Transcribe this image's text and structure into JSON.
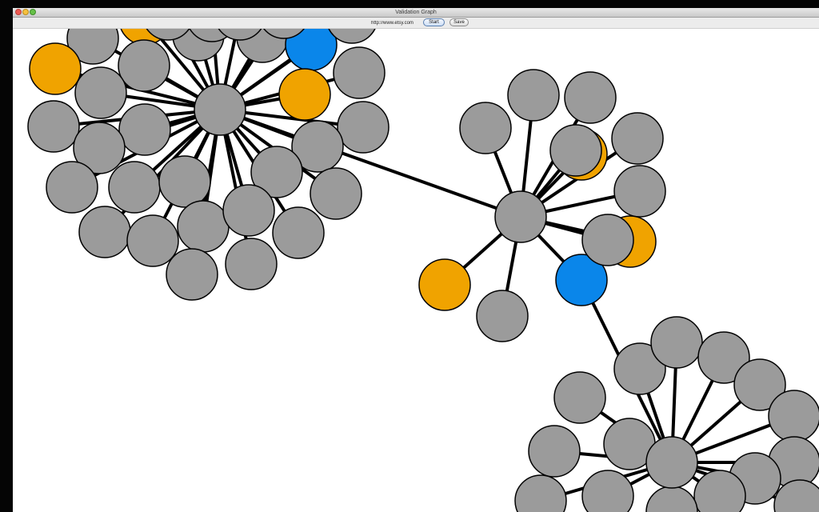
{
  "window": {
    "title": "Validation Graph",
    "controls": [
      "close",
      "minimize",
      "zoom"
    ]
  },
  "toolbar": {
    "url_value": "http://www.etsy.com",
    "start_label": "Start",
    "save_label": "Save"
  },
  "graph": {
    "node_colors": {
      "default": "#9b9b9b",
      "orange": "#f0a300",
      "blue": "#0a86ea"
    },
    "edge_color": "#000000",
    "clusters": [
      {
        "hub": "top-left",
        "leaf_count": 32,
        "leaf_states": {
          "default": 28,
          "orange": 3,
          "blue": 1
        }
      },
      {
        "hub": "middle",
        "leaf_count": 12,
        "leaf_states": {
          "default": 8,
          "orange": 3,
          "blue": 1
        }
      },
      {
        "hub": "bottom-right",
        "leaf_count": 15,
        "leaf_states": {
          "default": 15,
          "orange": 0,
          "blue": 0
        }
      }
    ],
    "hub_links": [
      "top-left to middle",
      "middle blue leaf to bottom-right"
    ]
  }
}
